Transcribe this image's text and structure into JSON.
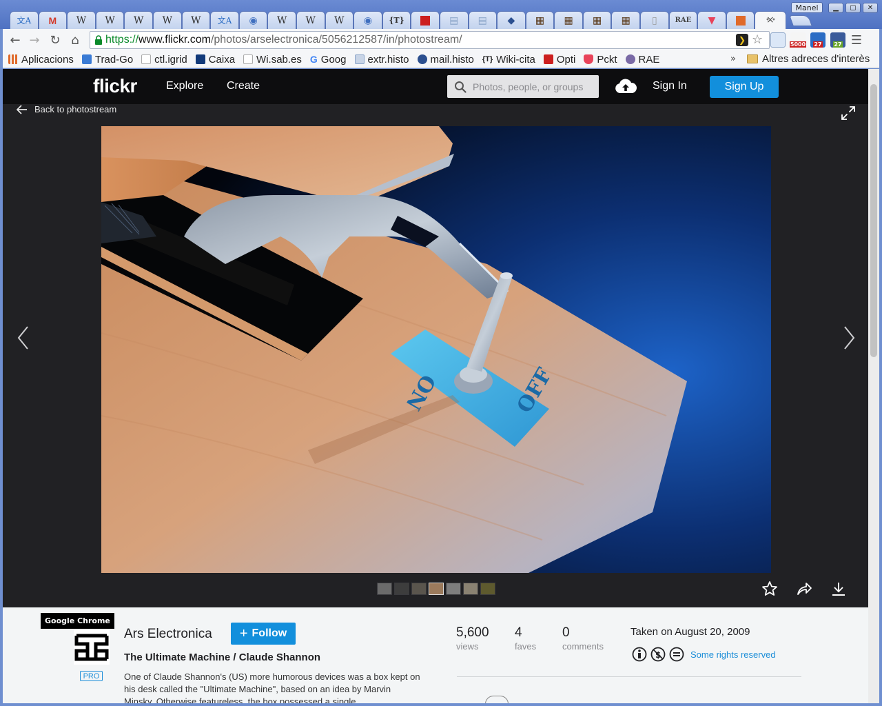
{
  "browser": {
    "profile_name": "Manel",
    "url_scheme": "https://",
    "url_host": "www.flickr.com",
    "url_path": "/photos/arselectronica/5056212587/in/photostream/",
    "tab_close_glyph": "×",
    "bookmarks": [
      {
        "label": "Aplicacions",
        "color": "#e06a2b"
      },
      {
        "label": "Trad-Go",
        "color": "#3a7bd5"
      },
      {
        "label": "ctl.igrid",
        "color": "#dddddd"
      },
      {
        "label": "Caixa",
        "color": "#123a7a"
      },
      {
        "label": "Wi.sab.es",
        "color": "#dddddd"
      },
      {
        "label": "Goog",
        "color": "#4285f4"
      },
      {
        "label": "extr.histo",
        "color": "#8aa4c8"
      },
      {
        "label": "mail.histo",
        "color": "#2b4f8f"
      },
      {
        "label": "Wiki-cita",
        "color": "#222222"
      },
      {
        "label": "Opti",
        "color": "#cc1f1f"
      },
      {
        "label": "Pckt",
        "color": "#e8435a"
      },
      {
        "label": "RAE",
        "color": "#7a6aa6"
      }
    ],
    "bookmarks_more": "»",
    "other_bookmarks": "Altres adreces d'interès",
    "extension_badges": [
      "5000",
      "27",
      "27"
    ]
  },
  "flickr": {
    "logo": "flickr",
    "nav": {
      "explore": "Explore",
      "create": "Create"
    },
    "search_placeholder": "Photos, people, or groups",
    "sign_in": "Sign In",
    "sign_up": "Sign Up",
    "back_link": "Back to photostream",
    "tooltip": "Google Chrome",
    "pro_badge": "PRO",
    "owner_name": "Ars Electronica",
    "follow_label": "Follow",
    "photo_title": "The Ultimate Machine / Claude Shannon",
    "photo_description": "One of Claude Shannon's (US) more humorous devices was a box kept on his desk called the \"Ultimate Machine\", based on an idea by Marvin Minsky. Otherwise featureless, the box possessed a single",
    "stats": [
      {
        "value": "5,600",
        "label": "views"
      },
      {
        "value": "4",
        "label": "faves"
      },
      {
        "value": "0",
        "label": "comments"
      }
    ],
    "taken_on": "Taken on August 20, 2009",
    "rights": "Some rights reserved",
    "accent_color": "#128fdc"
  }
}
